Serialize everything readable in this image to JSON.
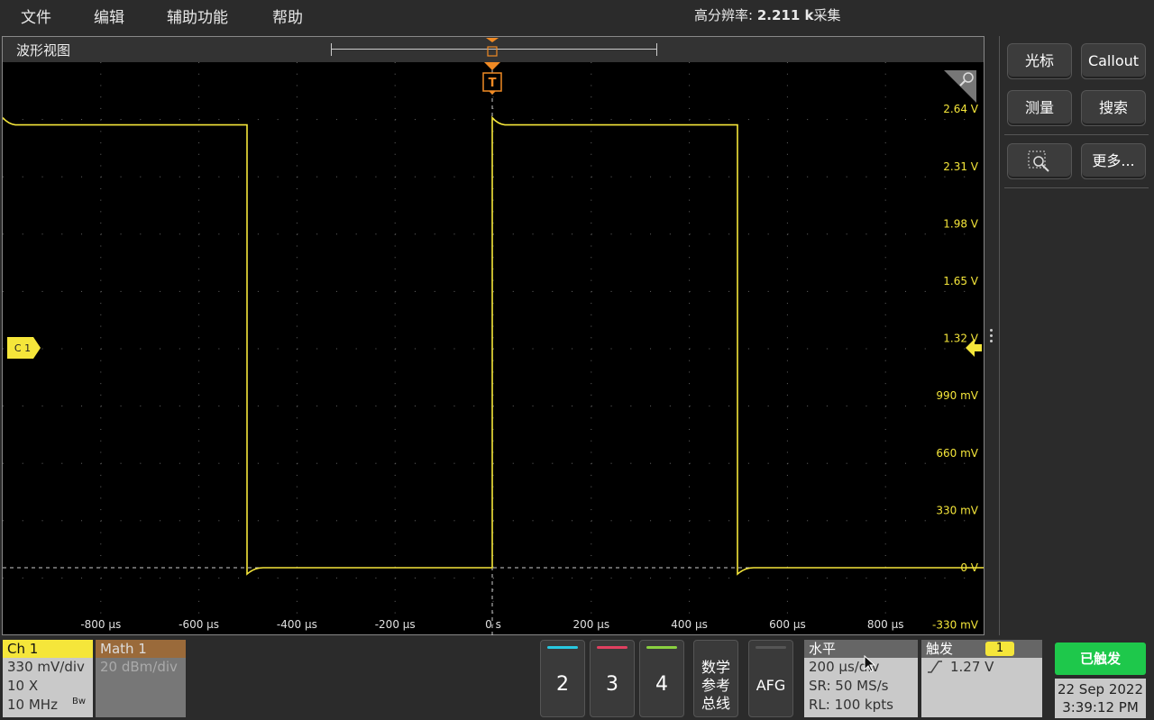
{
  "menu": {
    "items": [
      "文件",
      "编辑",
      "辅助功能",
      "帮助"
    ],
    "acq_label": "高分辨率: ",
    "acq_value": "2.211 k",
    "acq_suffix": "采集"
  },
  "waveform_view": {
    "title": "波形视图",
    "trigger_marker": "T",
    "channel_marker": "C 1",
    "y_labels": [
      "2.64 V",
      "2.31 V",
      "1.98 V",
      "1.65 V",
      "1.32 V",
      "990 mV",
      "660 mV",
      "330 mV",
      "0 V",
      "-330 mV"
    ],
    "x_labels": [
      "-800 µs",
      "-600 µs",
      "-400 µs",
      "-200 µs",
      "0 s",
      "200 µs",
      "400 µs",
      "600 µs",
      "800 µs"
    ]
  },
  "side_panel": {
    "cursor": "光标",
    "callout": "Callout",
    "measure": "测量",
    "search": "搜索",
    "more": "更多..."
  },
  "bottom": {
    "ch1": {
      "label": "Ch 1",
      "scale": "330 mV/div",
      "probe": "10 X",
      "bw": "10 MHz",
      "bw_icon": "Bw"
    },
    "math1": {
      "label": "Math 1",
      "scale": "20 dBm/div"
    },
    "channels": [
      "2",
      "3",
      "4"
    ],
    "math_ref_bus": [
      "数学",
      "参考",
      "总线"
    ],
    "afg": "AFG",
    "horizontal": {
      "label": "水平",
      "scale": "200 µs/div",
      "sr": "SR: 50 MS/s",
      "rl": "RL: 100 kpts"
    },
    "trigger": {
      "label": "触发",
      "source": "1",
      "level": "1.27 V"
    },
    "status": "已触发",
    "date": "22 Sep 2022",
    "time": "3:39:12 PM"
  },
  "colors": {
    "ch1": "#f5e63a",
    "trigger": "#f08a24",
    "ch2": "#28c8e0",
    "ch3": "#e04060",
    "ch4": "#8ad040",
    "status_green": "#1ec84b",
    "math": "#9a6a3a"
  }
}
